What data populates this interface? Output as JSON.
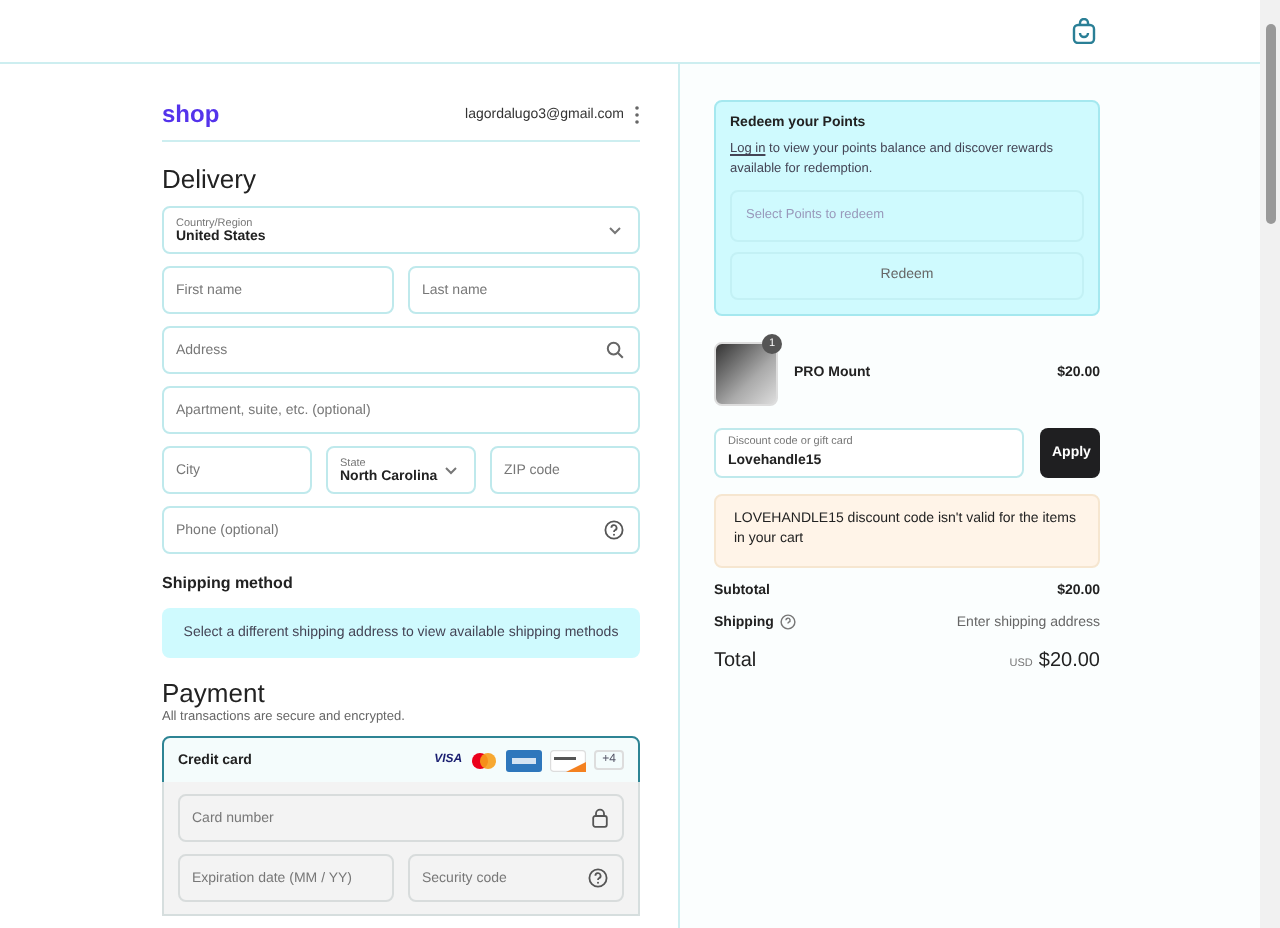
{
  "brand": "shop",
  "account": {
    "email": "lagordalugo3@gmail.com"
  },
  "delivery": {
    "title": "Delivery",
    "country": {
      "label": "Country/Region",
      "value": "United States"
    },
    "first_name": {
      "placeholder": "First name"
    },
    "last_name": {
      "placeholder": "Last name"
    },
    "address": {
      "placeholder": "Address"
    },
    "apartment": {
      "placeholder": "Apartment, suite, etc. (optional)"
    },
    "city": {
      "placeholder": "City"
    },
    "state": {
      "label": "State",
      "value": "North Carolina"
    },
    "zip": {
      "placeholder": "ZIP code"
    },
    "phone": {
      "placeholder": "Phone (optional)"
    }
  },
  "shipping_method": {
    "title": "Shipping method",
    "notice": "Select a different shipping address to view available shipping methods"
  },
  "payment": {
    "title": "Payment",
    "subtitle": "All transactions are secure and encrypted.",
    "method": {
      "label": "Credit card",
      "selected": true,
      "brands": [
        {
          "kind": "visa",
          "label": "VISA"
        },
        {
          "kind": "mastercard"
        },
        {
          "kind": "amex"
        },
        {
          "kind": "discover"
        },
        {
          "kind": "more",
          "label": "+4"
        }
      ]
    },
    "card_number": {
      "placeholder": "Card number"
    },
    "expiration": {
      "placeholder": "Expiration date (MM / YY)"
    },
    "security_code": {
      "placeholder": "Security code"
    }
  },
  "points": {
    "title": "Redeem your Points",
    "login_link": "Log in",
    "text": " to view your points balance and discover rewards available for redemption.",
    "select_placeholder": "Select Points to redeem",
    "button": "Redeem"
  },
  "cart": [
    {
      "name": "PRO Mount",
      "quantity": "1",
      "price": "$20.00"
    }
  ],
  "discount": {
    "label": "Discount code or gift card",
    "value": "Lovehandle15",
    "button": "Apply",
    "error": "LOVEHANDLE15 discount code isn't valid for the items in your cart"
  },
  "summary": {
    "subtotal_label": "Subtotal",
    "subtotal": "$20.00",
    "shipping_label": "Shipping",
    "shipping": "Enter shipping address",
    "total_label": "Total",
    "currency": "USD",
    "total": "$20.00"
  }
}
